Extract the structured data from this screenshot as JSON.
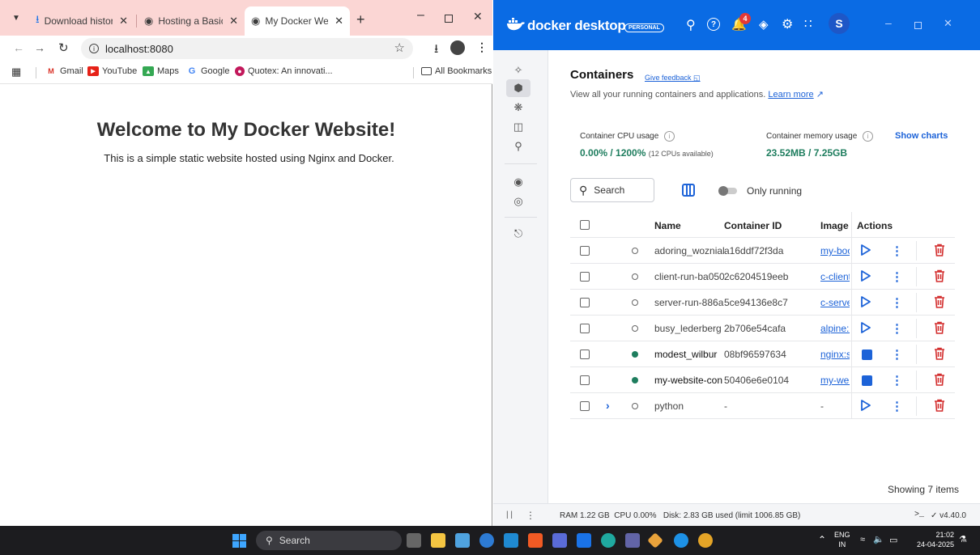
{
  "browser": {
    "tabs": [
      {
        "label": "Download history",
        "active": false
      },
      {
        "label": "Hosting a Basic W",
        "active": false
      },
      {
        "label": "My Docker Websit",
        "active": true
      }
    ],
    "url": "localhost:8080",
    "bookmarks": [
      "Gmail",
      "YouTube",
      "Maps",
      "Google",
      "Quotex: An innovati..."
    ],
    "all_bookmarks": "All Bookmarks",
    "page": {
      "heading": "Welcome to My Docker Website!",
      "paragraph": "This is a simple static website hosted using Nginx and Docker."
    }
  },
  "docker": {
    "brand": "docker desktop",
    "plan_badge": "PERSONAL",
    "notification_count": "4",
    "avatar_initial": "S",
    "title": "Containers",
    "feedback": "Give feedback",
    "subtitle": "View all your running containers and applications.",
    "learn_more": "Learn more",
    "cpu_label": "Container CPU usage",
    "cpu_value": "0.00% / 1200%",
    "cpu_note": "(12 CPUs available)",
    "mem_label": "Container memory usage",
    "mem_value": "23.52MB / 7.25GB",
    "show_charts": "Show charts",
    "search_placeholder": "Search",
    "only_running": "Only running",
    "columns": [
      "Name",
      "Container ID",
      "Image",
      "Actions"
    ],
    "rows": [
      {
        "name": "adoring_woznial",
        "id": "a16ddf72f3da",
        "image": "my-boot",
        "running": false
      },
      {
        "name": "client-run-ba050",
        "id": "2c6204519eeb",
        "image": "c-client",
        "running": false
      },
      {
        "name": "server-run-886a",
        "id": "5ce94136e8c7",
        "image": "c-server",
        "running": false
      },
      {
        "name": "busy_lederberg",
        "id": "2b706e54cafa",
        "image": "alpine:la",
        "running": false
      },
      {
        "name": "modest_wilbur",
        "id": "08bf96597634",
        "image": "nginx:st",
        "running": true
      },
      {
        "name": "my-website-con",
        "id": "50406e6e0104",
        "image": "my-web",
        "running": true
      },
      {
        "name": "python",
        "id": "-",
        "image": "-",
        "running": false,
        "group": true
      }
    ],
    "showing": "Showing 7 items",
    "footer": {
      "ram": "RAM 1.22 GB",
      "cpu": "CPU 0.00%",
      "disk": "Disk: 2.83 GB used (limit 1006.85 GB)",
      "version": "v4.40.0"
    },
    "colors": {
      "brand_blue": "#0a6be4",
      "running_green": "#1e7d5e",
      "delete_red": "#d32f2f",
      "cpu_green": "#1e7d5e"
    }
  },
  "taskbar": {
    "search": "Search",
    "lang": "ENG",
    "region": "IN",
    "time": "21:02",
    "date": "24-04-2025"
  }
}
